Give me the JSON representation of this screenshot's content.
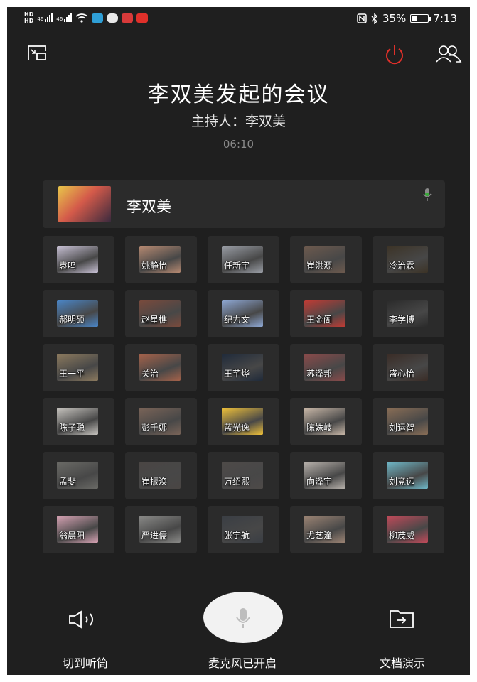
{
  "status_bar": {
    "net1": "46",
    "net2": "46",
    "battery": "35%",
    "time": "7:13",
    "nfc_icon": "nfc-icon",
    "bluetooth_icon": "bluetooth-icon"
  },
  "meeting": {
    "title": "李双美发起的会议",
    "host_line": "主持人：李双美",
    "elapsed": "06:10"
  },
  "host_card": {
    "name": "李双美"
  },
  "participants": [
    {
      "name": "袁鸣",
      "color": "#c9c2d6"
    },
    {
      "name": "姚静怡",
      "color": "#b78a72"
    },
    {
      "name": "任新宇",
      "color": "#9a9ea6"
    },
    {
      "name": "崔洪源",
      "color": "#6d5a4e"
    },
    {
      "name": "冷治霖",
      "color": "#3c3326"
    },
    {
      "name": "郝明硕",
      "color": "#4a86c8"
    },
    {
      "name": "赵星樵",
      "color": "#7a4a3c"
    },
    {
      "name": "纪力文",
      "color": "#8fa9d6"
    },
    {
      "name": "王金阁",
      "color": "#c23b34"
    },
    {
      "name": "李学博",
      "color": "#2a2a2a"
    },
    {
      "name": "王一平",
      "color": "#8c7a5e"
    },
    {
      "name": "关治",
      "color": "#a5624a"
    },
    {
      "name": "王芊烨",
      "color": "#1f2a3a"
    },
    {
      "name": "苏泽邦",
      "color": "#8a4a4a"
    },
    {
      "name": "盛心怡",
      "color": "#3a2c26"
    },
    {
      "name": "陈子聪",
      "color": "#c7c4bf"
    },
    {
      "name": "彭千娜",
      "color": "#7a6458"
    },
    {
      "name": "蓝光逸",
      "color": "#f0c23a"
    },
    {
      "name": "陈姝岐",
      "color": "#c9b8a8"
    },
    {
      "name": "刘运智",
      "color": "#8a6e56"
    },
    {
      "name": "孟斐",
      "color": "#6a6a66"
    },
    {
      "name": "崔振涣",
      "color": "#4a4644"
    },
    {
      "name": "万绍熙",
      "color": "#4e4a48"
    },
    {
      "name": "向泽宇",
      "color": "#b8b2ac"
    },
    {
      "name": "刘竞远",
      "color": "#6fb9c9"
    },
    {
      "name": "翁晨阳",
      "color": "#d7a3b4"
    },
    {
      "name": "严进儒",
      "color": "#8a8a88"
    },
    {
      "name": "张宇航",
      "color": "#3a3e44"
    },
    {
      "name": "尤艺潼",
      "color": "#9c8474"
    },
    {
      "name": "柳茂威",
      "color": "#c24a5a"
    }
  ],
  "controls": {
    "earpiece_label": "切到听筒",
    "mic_label": "麦克风已开启",
    "share_label": "文档演示"
  },
  "icons": {
    "top_left": "minimize-window-icon",
    "power": "power-icon",
    "members": "members-icon",
    "speaker": "speaker-icon",
    "mic": "microphone-icon",
    "share": "folder-share-icon"
  },
  "colors": {
    "background": "#1f1f1f",
    "card": "#2b2b2b",
    "power": "#e0302a",
    "mic_active": "#3aa83a"
  }
}
